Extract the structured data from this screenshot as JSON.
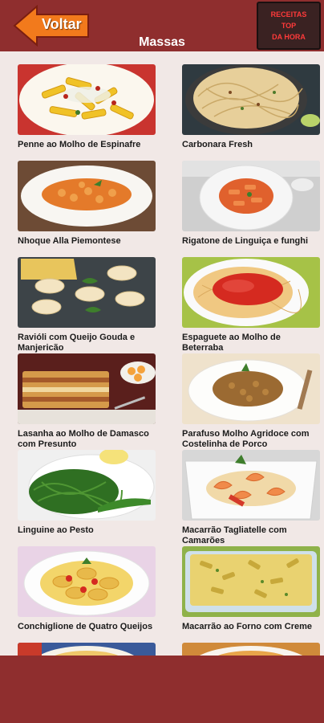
{
  "header": {
    "back_label": "Voltar",
    "title": "Massas",
    "badge_lines": [
      "RECEITAS",
      "TOP",
      "DA HORA"
    ],
    "accent": "#f27a1c",
    "bar_color": "#8f2e2e"
  },
  "recipes": [
    {
      "name": "Penne ao Molho de Espinafre",
      "icon": "penne-photo"
    },
    {
      "name": "Carbonara Fresh",
      "icon": "carbonara-photo"
    },
    {
      "name": "Nhoque Alla Piemontese",
      "icon": "gnocchi-photo"
    },
    {
      "name": "Rigatone de Linguiça e funghi",
      "icon": "rigatoni-photo"
    },
    {
      "name": "Ravióli com Queijo Gouda e Manjericão",
      "icon": "ravioli-photo"
    },
    {
      "name": "Espaguete ao Molho de Beterraba",
      "icon": "spaghetti-photo"
    },
    {
      "name": "Lasanha ao Molho de Damasco com Presunto",
      "icon": "lasagna-photo"
    },
    {
      "name": "Parafuso Molho Agridoce com Costelinha de Porco",
      "icon": "fusilli-photo"
    },
    {
      "name": "Linguine ao Pesto",
      "icon": "linguine-photo"
    },
    {
      "name": " Macarrão Tagliatelle com Camarões",
      "icon": "tagliatelle-photo"
    },
    {
      "name": "Conchiglione de Quatro Queijos",
      "icon": "conchiglione-photo"
    },
    {
      "name": "Macarrão ao Forno com Creme",
      "icon": "baked-pasta-photo"
    }
  ]
}
